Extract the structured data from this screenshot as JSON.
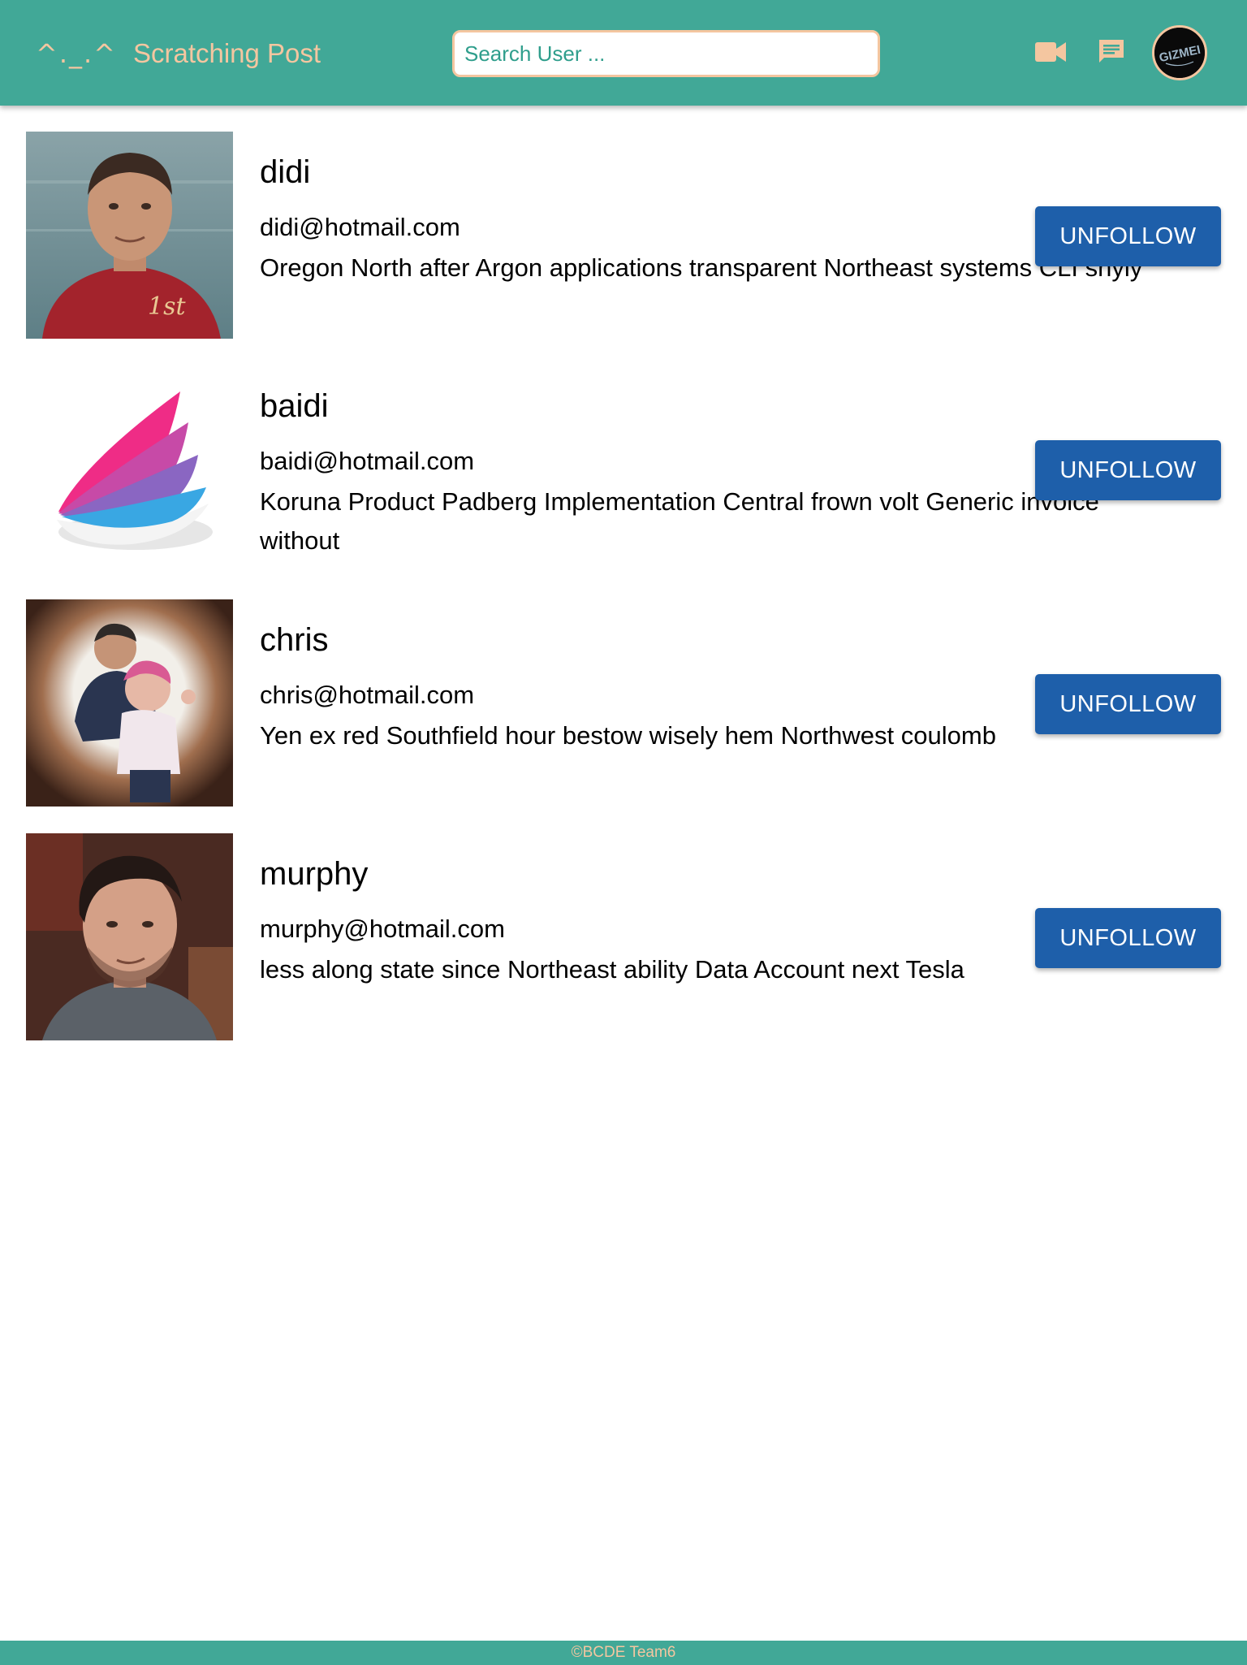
{
  "header": {
    "logo_text": "^._.^",
    "title": "Scratching Post",
    "search_placeholder": "Search User ...",
    "video_icon": "video-camera-icon",
    "chat_icon": "chat-message-icon",
    "avatar_text": "GIZMEI"
  },
  "colors": {
    "appbar": "#41a897",
    "accent": "#f4c6a0",
    "button": "#1e5faa"
  },
  "users": [
    {
      "name": "didi",
      "email": "didi@hotmail.com",
      "bio": "Oregon North after Argon applications transparent Northeast systems CLI shyly",
      "button_label": "UNFOLLOW"
    },
    {
      "name": "baidi",
      "email": "baidi@hotmail.com",
      "bio": "Koruna Product Padberg Implementation Central frown volt Generic invoice without",
      "button_label": "UNFOLLOW"
    },
    {
      "name": "chris",
      "email": "chris@hotmail.com",
      "bio": "Yen ex red Southfield hour bestow wisely hem Northwest coulomb",
      "button_label": "UNFOLLOW"
    },
    {
      "name": "murphy",
      "email": "murphy@hotmail.com",
      "bio": "less along state since Northeast ability Data Account next Tesla",
      "button_label": "UNFOLLOW"
    }
  ],
  "footer": {
    "text": "©BCDE Team6"
  }
}
